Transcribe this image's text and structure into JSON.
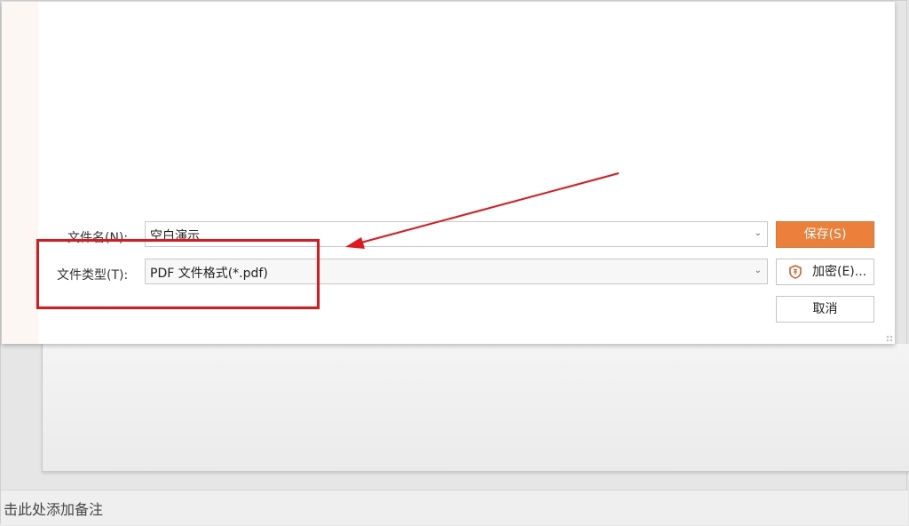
{
  "dialog": {
    "filename_label": "文件名(N):",
    "filename_value": "空白演示",
    "filetype_label": "文件类型(T):",
    "filetype_value": "PDF 文件格式(*.pdf)",
    "save_button": "保存(S)",
    "encrypt_button": "加密(E)...",
    "cancel_button": "取消"
  },
  "notes": {
    "placeholder": "击此处添加备注"
  },
  "colors": {
    "accent": "#ec7f3a",
    "annotation": "#e2161b"
  },
  "icons": {
    "dropdown": "chevron-down-icon",
    "encrypt": "shield-icon"
  }
}
